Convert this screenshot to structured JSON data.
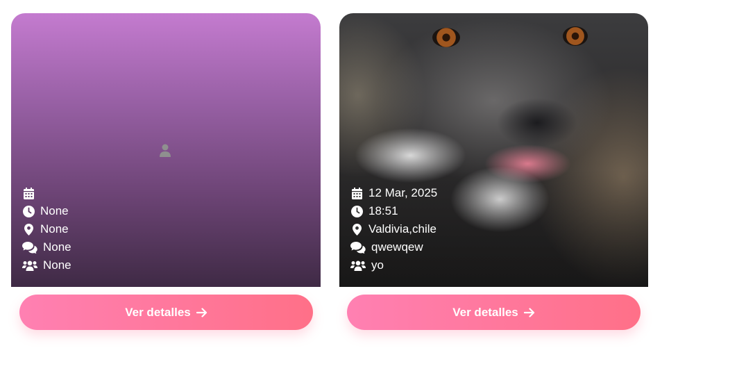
{
  "cards": [
    {
      "date": "",
      "time": "None",
      "location": "None",
      "description": "None",
      "participants": "None",
      "button_label": "Ver detalles",
      "has_photo": false
    },
    {
      "date": "12 Mar, 2025",
      "time": "18:51",
      "location": "Valdivia,chile",
      "description": "qwewqew",
      "participants": "yo",
      "button_label": "Ver detalles",
      "has_photo": true
    }
  ],
  "icons": {
    "date": "calendar-icon",
    "time": "clock-icon",
    "location": "map-pin-icon",
    "description": "comments-icon",
    "participants": "users-icon",
    "placeholder": "user-icon",
    "button": "arrow-right-icon"
  },
  "colors": {
    "button_start": "#ff80b2",
    "button_end": "#ff7088",
    "card_gradient_top": "#c47bcf",
    "card_gradient_bottom": "#3f2a45"
  }
}
